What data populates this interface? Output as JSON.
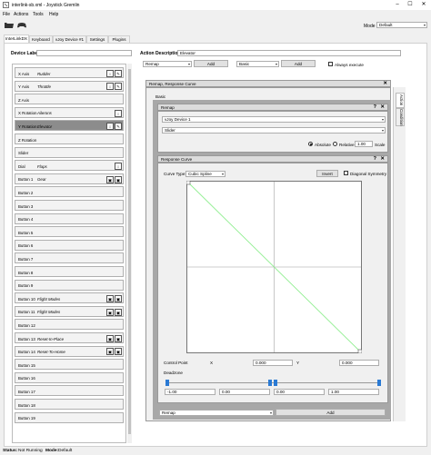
{
  "window": {
    "title": "interlink-sb.xml - Joystick Gremlin",
    "controls": [
      "–",
      "☐",
      "✕"
    ]
  },
  "menu": [
    "File",
    "Actions",
    "Tools",
    "Help"
  ],
  "toolbar": {
    "icons": [
      "folder-open-icon",
      "gamepad-icon"
    ],
    "mode_label": "Mode",
    "mode_value": "Default"
  },
  "tabs": [
    {
      "label": "InterLinkDX",
      "active": true
    },
    {
      "label": "Keyboard",
      "active": false
    },
    {
      "label": "vJoy Device #1",
      "active": false
    },
    {
      "label": "Settings",
      "active": false
    },
    {
      "label": "Plugins",
      "active": false
    }
  ],
  "device_label": {
    "label": "Device Label",
    "value": ""
  },
  "devices": [
    {
      "name": "X Axis",
      "desc": "Rudder",
      "icons": [
        "axis",
        "edit"
      ]
    },
    {
      "name": "Y Axis",
      "desc": "Throttle",
      "icons": [
        "axis",
        "edit"
      ]
    },
    {
      "name": "Z Axis",
      "desc": "",
      "icons": []
    },
    {
      "name": "X Rotation",
      "desc": "Ailerons",
      "icons": [
        "axis"
      ]
    },
    {
      "name": "Y Rotation",
      "desc": "Elevator",
      "icons": [
        "axis",
        "edit"
      ],
      "selected": true
    },
    {
      "name": "Z Rotation",
      "desc": "",
      "icons": []
    },
    {
      "name": "Slider",
      "desc": "",
      "icons": []
    },
    {
      "name": "Dial",
      "desc": "Flaps",
      "icons": [
        "axis"
      ]
    },
    {
      "name": "Button 1",
      "desc": "Gear",
      "icons": [
        "btn",
        "btn"
      ]
    },
    {
      "name": "Button 2",
      "desc": "",
      "icons": []
    },
    {
      "name": "Button 3",
      "desc": "",
      "icons": []
    },
    {
      "name": "Button 4",
      "desc": "",
      "icons": []
    },
    {
      "name": "Button 5",
      "desc": "",
      "icons": []
    },
    {
      "name": "Button 6",
      "desc": "",
      "icons": []
    },
    {
      "name": "Button 7",
      "desc": "",
      "icons": []
    },
    {
      "name": "Button 8",
      "desc": "",
      "icons": []
    },
    {
      "name": "Button 9",
      "desc": "",
      "icons": []
    },
    {
      "name": "Button 10",
      "desc": "Flight Modes",
      "icons": [
        "btn",
        "btn"
      ]
    },
    {
      "name": "Button 11",
      "desc": "Flight Modes",
      "icons": [
        "btn",
        "btn"
      ]
    },
    {
      "name": "Button 12",
      "desc": "",
      "icons": []
    },
    {
      "name": "Button 13",
      "desc": "Reset-In-Place",
      "icons": [
        "btn",
        "btn"
      ]
    },
    {
      "name": "Button 14",
      "desc": "Reset-To-Home",
      "icons": [
        "btn",
        "btn"
      ]
    },
    {
      "name": "Button 15",
      "desc": "",
      "icons": []
    },
    {
      "name": "Button 16",
      "desc": "",
      "icons": []
    },
    {
      "name": "Button 17",
      "desc": "",
      "icons": []
    },
    {
      "name": "Button 18",
      "desc": "",
      "icons": []
    },
    {
      "name": "Button 19",
      "desc": "",
      "icons": []
    }
  ],
  "action": {
    "desc_label": "Action Description",
    "desc_value": "Elevator",
    "combo1": "Remap",
    "add1": "Add",
    "combo2": "Basic",
    "add2": "Add",
    "always_execute": "Always execute",
    "container_title": "Remap, Response Curve",
    "basic_tab": "Basic",
    "side_tabs": [
      "Action",
      "Condition"
    ]
  },
  "remap": {
    "title": "Remap",
    "device": "vJoy Device 1",
    "axis": "Slider",
    "absolute": "Absolute",
    "relative": "Relative",
    "rel_value": "1.00",
    "scale": "Scale"
  },
  "curve": {
    "title": "Response Curve",
    "type_label": "Curve Type:",
    "type_value": "Cubic Spline",
    "invert": "Invert",
    "diagonal": "Diagonal Symmetry",
    "control_point": "Control Point",
    "x_label": "X",
    "x_value": "0.000",
    "y_label": "Y",
    "y_value": "0.000",
    "deadzone": "Deadzone",
    "dz_values": [
      "-1.00",
      "0.00",
      "0.00",
      "1.00"
    ],
    "line_color": "#90ee90"
  },
  "bottom": {
    "combo": "Remap",
    "add": "Add"
  },
  "status": {
    "status_label": "Status:",
    "status_value": "Not Running",
    "mode_label": "Mode:",
    "mode_value": "Default"
  },
  "colors": {
    "selected_item": "#8c8c8c",
    "container_bg": "#a8a8a8"
  }
}
